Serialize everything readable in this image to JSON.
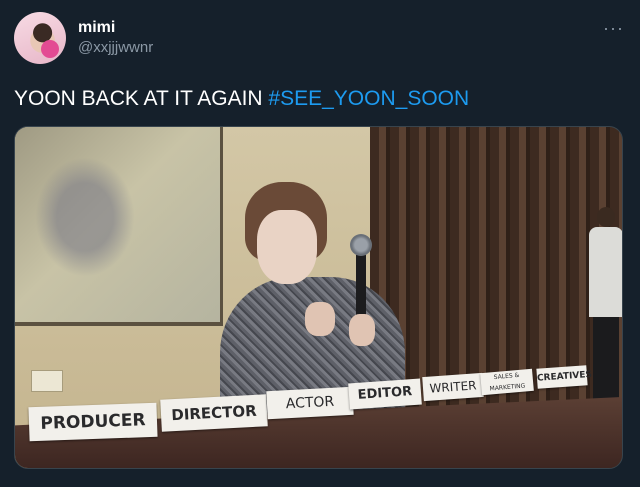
{
  "tweet": {
    "author_name": "mimi",
    "author_handle": "@xxjjjwwnr",
    "more_label": "···",
    "text_plain": "YOON BACK AT IT AGAIN ",
    "hashtag": "#SEE_YOON_SOON"
  },
  "image": {
    "table_labels": [
      {
        "text": "PRODUCER"
      },
      {
        "text": "DIRECTOR"
      },
      {
        "text": "ACTOR"
      },
      {
        "text": "EDITOR"
      },
      {
        "text": "WRITER"
      },
      {
        "text": "SALES & MARKETING"
      },
      {
        "text": "CREATIVES"
      }
    ]
  },
  "colors": {
    "background": "#15202b",
    "hashtag": "#1d9bf0",
    "secondary_text": "#8b98a5"
  }
}
